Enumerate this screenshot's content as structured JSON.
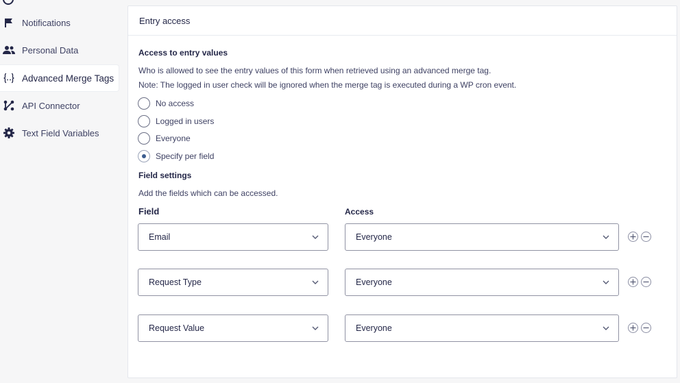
{
  "sidebar": {
    "items": [
      {
        "label": "Notifications",
        "icon": "flag-icon"
      },
      {
        "label": "Personal Data",
        "icon": "users-icon"
      },
      {
        "label": "Advanced Merge Tags",
        "icon": "merge-tag-icon"
      },
      {
        "label": "API Connector",
        "icon": "api-connector-icon"
      },
      {
        "label": "Text Field Variables",
        "icon": "gear-icon"
      }
    ],
    "active_index": 2
  },
  "panel": {
    "title": "Entry access",
    "access_title": "Access to entry values",
    "desc_line1": "Who is allowed to see the entry values of this form when retrieved using an advanced merge tag.",
    "desc_line2": "Note: The logged in user check will be ignored when the merge tag is executed during a WP cron event.",
    "radio_options": [
      "No access",
      "Logged in users",
      "Everyone",
      "Specify per field"
    ],
    "selected_option": "Specify per field",
    "field_settings_title": "Field settings",
    "field_settings_desc": "Add the fields which can be accessed.",
    "col_field": "Field",
    "col_access": "Access",
    "rows": [
      {
        "field": "Email",
        "access": "Everyone"
      },
      {
        "field": "Request Type",
        "access": "Everyone"
      },
      {
        "field": "Request Value",
        "access": "Everyone"
      }
    ]
  },
  "colors": {
    "accent": "#3c5d8f",
    "text": "#242748",
    "border": "#9092a3"
  }
}
